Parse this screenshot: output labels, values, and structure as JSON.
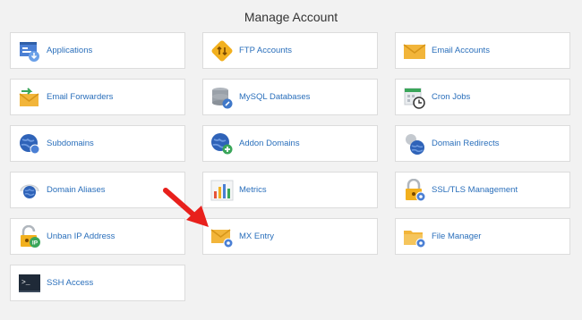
{
  "header": {
    "title": "Manage Account"
  },
  "tiles": [
    {
      "label": "Applications",
      "icon": "applications-icon"
    },
    {
      "label": "FTP Accounts",
      "icon": "ftp-accounts-icon"
    },
    {
      "label": "Email Accounts",
      "icon": "email-accounts-icon"
    },
    {
      "label": "Email Forwarders",
      "icon": "email-forwarders-icon"
    },
    {
      "label": "MySQL Databases",
      "icon": "mysql-databases-icon"
    },
    {
      "label": "Cron Jobs",
      "icon": "cron-jobs-icon"
    },
    {
      "label": "Subdomains",
      "icon": "subdomains-icon"
    },
    {
      "label": "Addon Domains",
      "icon": "addon-domains-icon"
    },
    {
      "label": "Domain Redirects",
      "icon": "domain-redirects-icon"
    },
    {
      "label": "Domain Aliases",
      "icon": "domain-aliases-icon"
    },
    {
      "label": "Metrics",
      "icon": "metrics-icon"
    },
    {
      "label": "SSL/TLS Management",
      "icon": "ssl-tls-icon"
    },
    {
      "label": "Unban IP Address",
      "icon": "unban-ip-icon"
    },
    {
      "label": "MX Entry",
      "icon": "mx-entry-icon"
    },
    {
      "label": "File Manager",
      "icon": "file-manager-icon"
    },
    {
      "label": "SSH Access",
      "icon": "ssh-access-icon"
    }
  ],
  "icon_labels": {
    "unban_ip": "IP",
    "ssh_prompt": ">_"
  },
  "colors": {
    "background": "#f2f2f2",
    "tile": "#ffffff",
    "link": "#2a6fbb",
    "arrow": "#e8201c"
  }
}
